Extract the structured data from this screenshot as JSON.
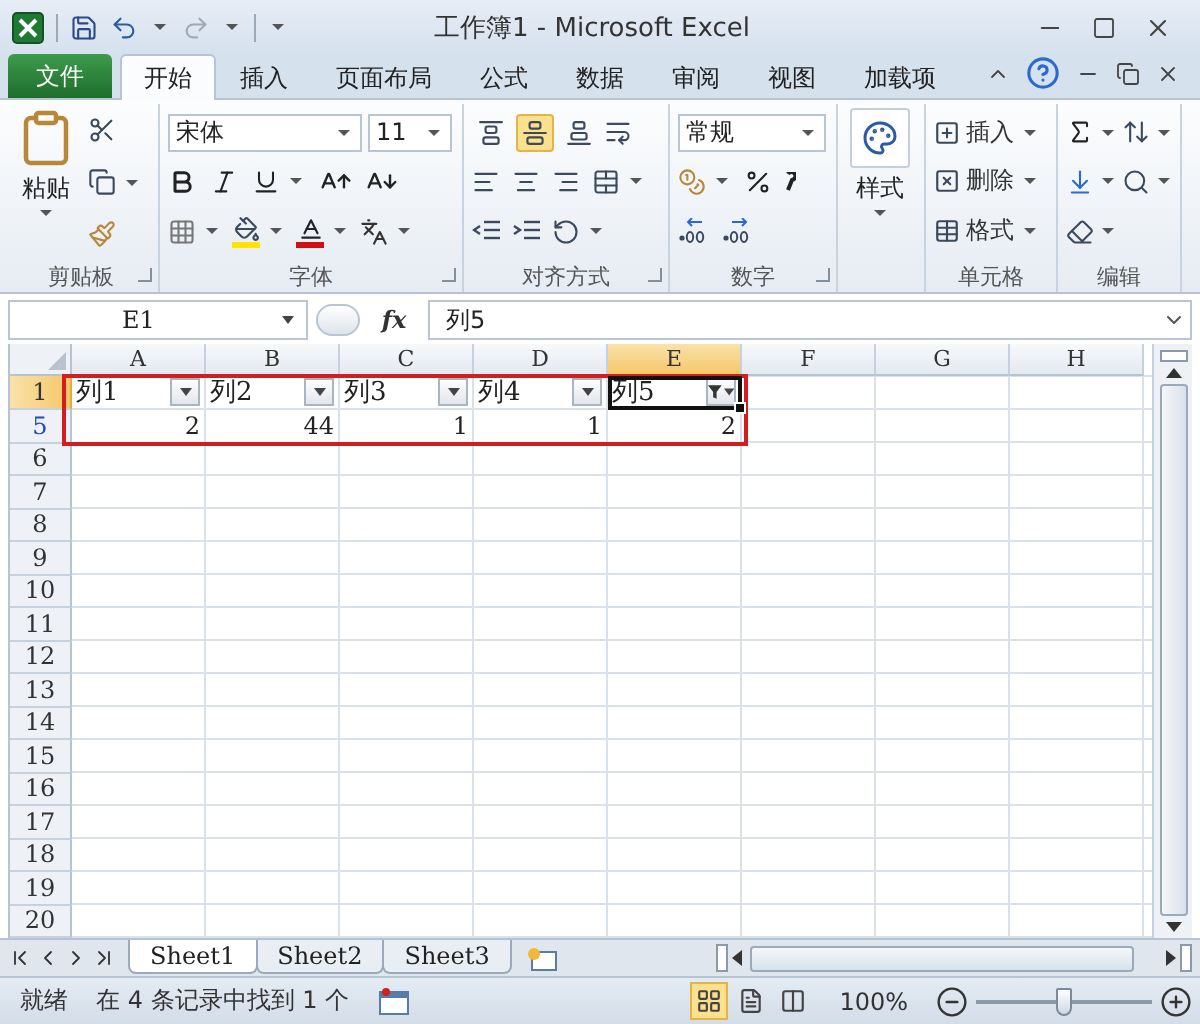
{
  "window": {
    "title": "工作簿1 - Microsoft Excel"
  },
  "ribbon": {
    "tabs": [
      {
        "label": "文件",
        "kind": "file",
        "selected": false
      },
      {
        "label": "开始",
        "kind": "tab",
        "selected": true
      },
      {
        "label": "插入",
        "kind": "tab",
        "selected": false
      },
      {
        "label": "页面布局",
        "kind": "tab",
        "selected": false
      },
      {
        "label": "公式",
        "kind": "tab",
        "selected": false
      },
      {
        "label": "数据",
        "kind": "tab",
        "selected": false
      },
      {
        "label": "审阅",
        "kind": "tab",
        "selected": false
      },
      {
        "label": "视图",
        "kind": "tab",
        "selected": false
      },
      {
        "label": "加载项",
        "kind": "tab",
        "selected": false
      }
    ],
    "groups": [
      {
        "kind": "clipboard",
        "label": "剪贴板",
        "button": "粘贴"
      },
      {
        "kind": "font",
        "label": "字体",
        "font": "宋体",
        "size": "11"
      },
      {
        "kind": "alignment",
        "label": "对齐方式",
        "vertical_align": [
          {
            "selected": false
          },
          {
            "selected": true
          },
          {
            "selected": false
          }
        ]
      },
      {
        "kind": "number",
        "label": "数字",
        "format": "常规"
      },
      {
        "kind": "styles",
        "button": "样式"
      },
      {
        "kind": "cells",
        "label": "单元格",
        "buttons": [
          "插入",
          "删除",
          "格式"
        ]
      },
      {
        "kind": "editing",
        "label": "编辑"
      }
    ]
  },
  "formula_bar": {
    "name_box": "E1",
    "function_label": "fx",
    "formula": "列5"
  },
  "sheet": {
    "columns": [
      {
        "label": "A",
        "selected": false
      },
      {
        "label": "B",
        "selected": false
      },
      {
        "label": "C",
        "selected": false
      },
      {
        "label": "D",
        "selected": false
      },
      {
        "label": "E",
        "selected": true
      },
      {
        "label": "F",
        "selected": false
      },
      {
        "label": "G",
        "selected": false
      },
      {
        "label": "H",
        "selected": false
      }
    ],
    "rows": [
      {
        "label": "1",
        "selected": true,
        "filtered": false,
        "cells": [
          {
            "kind": "header",
            "text": "列1",
            "selected": false,
            "filtered": false
          },
          {
            "kind": "header",
            "text": "列2",
            "selected": false,
            "filtered": false
          },
          {
            "kind": "header",
            "text": "列3",
            "selected": false,
            "filtered": false
          },
          {
            "kind": "header",
            "text": "列4",
            "selected": false,
            "filtered": false
          },
          {
            "kind": "header",
            "text": "列5",
            "selected": true,
            "filtered": true
          }
        ]
      },
      {
        "label": "5",
        "selected": false,
        "filtered": true,
        "cells": [
          {
            "kind": "number",
            "text": "2"
          },
          {
            "kind": "number",
            "text": "44"
          },
          {
            "kind": "number",
            "text": "1"
          },
          {
            "kind": "number",
            "text": "1"
          },
          {
            "kind": "number",
            "text": "2"
          }
        ]
      },
      {
        "label": "6",
        "selected": false,
        "filtered": false
      },
      {
        "label": "7",
        "selected": false,
        "filtered": false
      },
      {
        "label": "8",
        "selected": false,
        "filtered": false
      },
      {
        "label": "9",
        "selected": false,
        "filtered": false
      },
      {
        "label": "10",
        "selected": false,
        "filtered": false
      },
      {
        "label": "11",
        "selected": false,
        "filtered": false
      },
      {
        "label": "12",
        "selected": false,
        "filtered": false
      },
      {
        "label": "13",
        "selected": false,
        "filtered": false
      },
      {
        "label": "14",
        "selected": false,
        "filtered": false
      },
      {
        "label": "15",
        "selected": false,
        "filtered": false
      },
      {
        "label": "16",
        "selected": false,
        "filtered": false
      },
      {
        "label": "17",
        "selected": false,
        "filtered": false
      },
      {
        "label": "18",
        "selected": false,
        "filtered": false
      },
      {
        "label": "19",
        "selected": false,
        "filtered": false
      },
      {
        "label": "20",
        "selected": false,
        "filtered": false
      }
    ]
  },
  "sheet_tabs": [
    {
      "label": "Sheet1",
      "selected": true
    },
    {
      "label": "Sheet2",
      "selected": false
    },
    {
      "label": "Sheet3",
      "selected": false
    }
  ],
  "status_bar": {
    "mode": "就绪",
    "message": "在 4 条记录中找到 1 个",
    "views": [
      {
        "kind": "normal",
        "selected": true
      },
      {
        "kind": "page_layout",
        "selected": false
      },
      {
        "kind": "page_break",
        "selected": false
      }
    ],
    "zoom": "100%",
    "zoom_slider": {
      "level": 0.5
    }
  }
}
